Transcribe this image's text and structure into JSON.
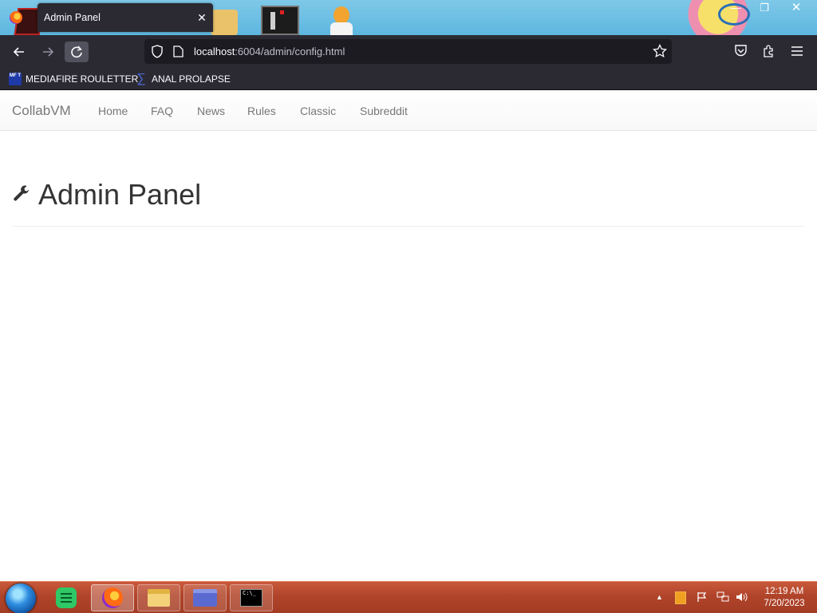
{
  "browser": {
    "tab": {
      "title": "Admin Panel",
      "close_glyph": "✕"
    },
    "window": {
      "minimize": "—",
      "maximize": "❐",
      "close": "✕"
    },
    "url": {
      "host": "localhost",
      "rest": ":6004/admin/config.html"
    }
  },
  "bookmarks": {
    "items": [
      {
        "label": "MEDIAFIRE ROULETTER",
        "icon": "mft-icon",
        "icon_text": "MF T"
      },
      {
        "label": "ANAL PROLAPSE",
        "icon": "sigma-icon",
        "icon_text": "∑"
      }
    ]
  },
  "site": {
    "brand": "CollabVM",
    "nav": [
      "Home",
      "FAQ",
      "News",
      "Rules",
      "Classic",
      "Subreddit"
    ],
    "page_title": "Admin Panel"
  },
  "taskbar": {
    "cmd_text": "C:\\_",
    "clock": {
      "time": "12:19 AM",
      "date": "7/20/2023"
    }
  },
  "colors": {
    "browser_chrome": "#2b2a33",
    "urlbar": "#1c1b22",
    "taskbar": "#b0442a",
    "page_title": "#333333",
    "nav_link": "#777777"
  }
}
